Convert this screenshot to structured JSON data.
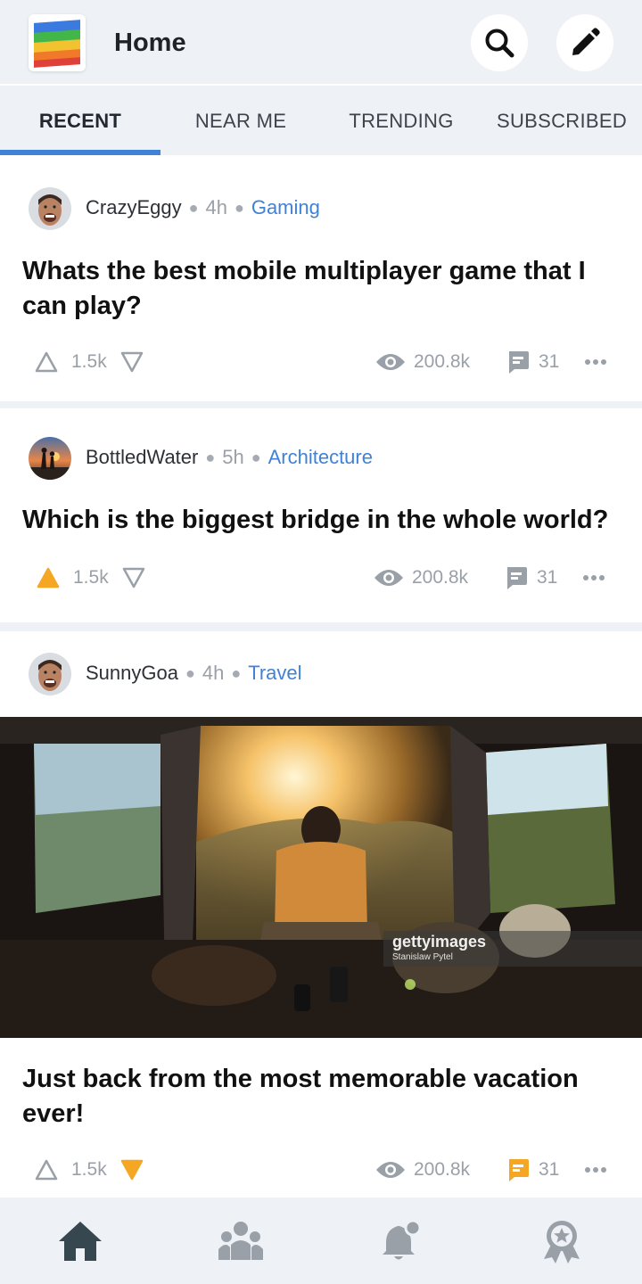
{
  "header": {
    "title": "Home"
  },
  "tabs": [
    {
      "label": "RECENT",
      "active": true
    },
    {
      "label": "NEAR ME",
      "active": false
    },
    {
      "label": "TRENDING",
      "active": false
    },
    {
      "label": "SUBSCRIBED",
      "active": false
    }
  ],
  "posts": [
    {
      "author": "CrazyEggy",
      "time": "4h",
      "category": "Gaming",
      "title": "Whats the best mobile multiplayer game that I can play?",
      "votes": "1.5k",
      "vote_state": "none",
      "views": "200.8k",
      "comments": "31",
      "comment_highlight": false
    },
    {
      "author": "BottledWater",
      "time": "5h",
      "category": "Architecture",
      "title": "Which is the biggest bridge in the whole world?",
      "votes": "1.5k",
      "vote_state": "upvoted",
      "views": "200.8k",
      "comments": "31",
      "comment_highlight": false
    },
    {
      "author": "SunnyGoa",
      "time": "4h",
      "category": "Travel",
      "title": "Just back from the most memorable vacation ever!",
      "image_watermark": {
        "brand": "gettyimages",
        "credit": "Stanislaw Pytel"
      },
      "votes": "1.5k",
      "vote_state": "downvoted",
      "views": "200.8k",
      "comments": "31",
      "comment_highlight": true
    }
  ],
  "bottom_nav": [
    {
      "name": "home",
      "active": true
    },
    {
      "name": "community",
      "active": false
    },
    {
      "name": "notifications",
      "active": false
    },
    {
      "name": "achievements",
      "active": false
    }
  ],
  "colors": {
    "accent": "#3f82d6",
    "vote_active": "#f5a623",
    "icon_gray": "#9aa0a8",
    "nav_active": "#37474f"
  }
}
